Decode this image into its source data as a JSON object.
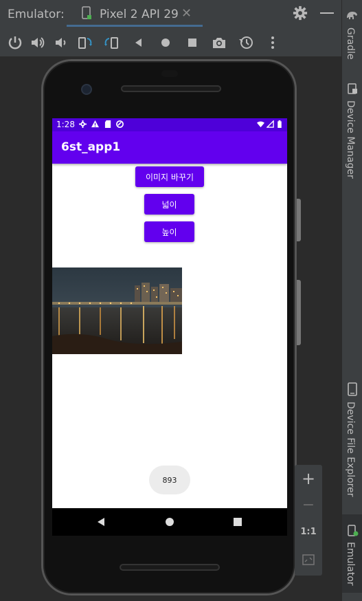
{
  "header": {
    "title": "Emulator:",
    "tab_label": "Pixel 2 API 29",
    "close_glyph": "✕"
  },
  "toolbar": {
    "icons": [
      "power-icon",
      "volume-up-icon",
      "volume-down-icon",
      "rotate-left-icon",
      "rotate-right-icon",
      "back-icon",
      "home-icon",
      "overview-icon",
      "screenshot-icon",
      "snapshot-icon",
      "more-icon"
    ]
  },
  "side_strip": {
    "gradle": "Gradle",
    "device_manager": "Device Manager",
    "device_file_explorer": "Device File Explorer",
    "emulator": "Emulator"
  },
  "device": {
    "status_time": "1:28",
    "app_title": "6st_app1",
    "buttons": {
      "change_image": "이미지 바꾸기",
      "width": "넓이",
      "height": "높이"
    },
    "toast_text": "893"
  },
  "zoom_panel": {
    "zoom_in": "+",
    "zoom_out": "−",
    "actual_size": "1:1"
  },
  "colors": {
    "app_primary": "#6200ee",
    "status_bar": "#4e00d9",
    "ide_background": "#3c3f41",
    "emulator_background": "#2b2b2b"
  }
}
